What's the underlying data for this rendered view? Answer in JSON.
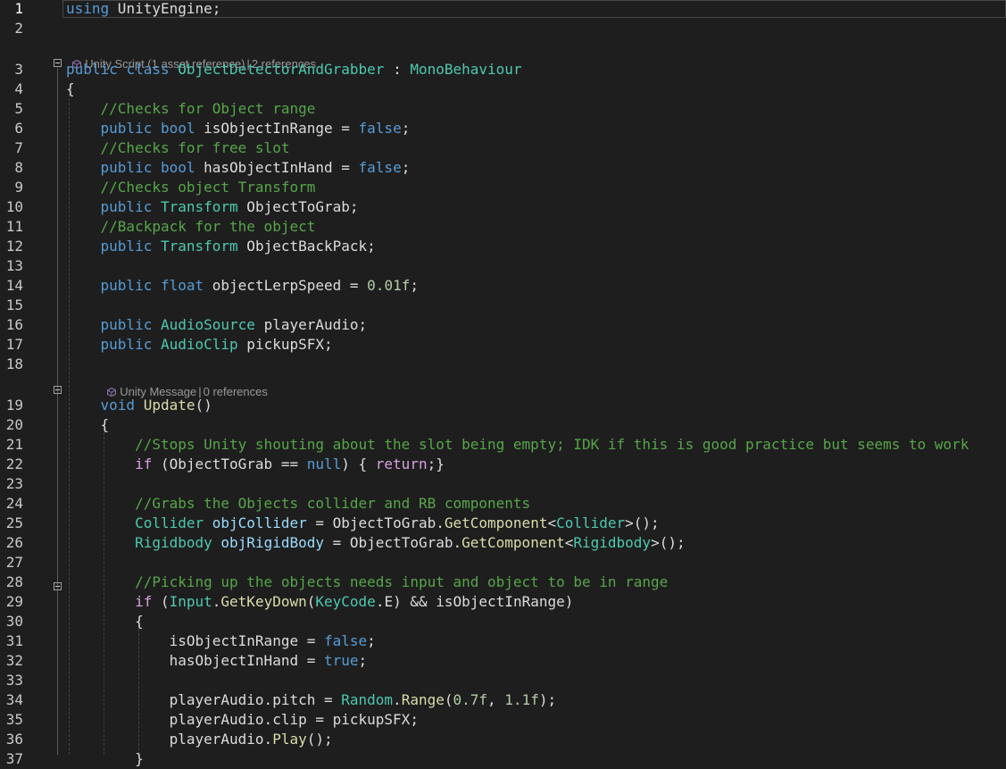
{
  "editor": {
    "line_numbers": [
      "1",
      "2",
      "3",
      "4",
      "5",
      "6",
      "7",
      "8",
      "9",
      "10",
      "11",
      "12",
      "13",
      "14",
      "15",
      "16",
      "17",
      "18",
      "19",
      "20",
      "21",
      "22",
      "23",
      "24",
      "25",
      "26",
      "27",
      "28",
      "29",
      "30",
      "31",
      "32",
      "33",
      "34",
      "35",
      "36",
      "37"
    ],
    "codelens": {
      "class_lens": {
        "kind": "Unity Script (1 asset reference)",
        "sep": "|",
        "refs": "2 references"
      },
      "method_lens": {
        "kind": "Unity Message",
        "sep": "|",
        "refs": "0 references"
      }
    },
    "lines": [
      [
        {
          "t": "using",
          "c": "kw"
        },
        {
          "t": " UnityEngine;",
          "c": "pl"
        }
      ],
      [],
      [
        {
          "t": "public",
          "c": "kw"
        },
        {
          "t": " ",
          "c": "pl"
        },
        {
          "t": "class",
          "c": "kw"
        },
        {
          "t": " ",
          "c": "pl"
        },
        {
          "t": "ObjectDetectorAndGrabber",
          "c": "cls"
        },
        {
          "t": " : ",
          "c": "pl"
        },
        {
          "t": "MonoBehaviour",
          "c": "cls"
        }
      ],
      [
        {
          "t": "{",
          "c": "pl"
        }
      ],
      [
        {
          "t": "    ",
          "c": "pl"
        },
        {
          "t": "//Checks for Object range",
          "c": "cm"
        }
      ],
      [
        {
          "t": "    ",
          "c": "pl"
        },
        {
          "t": "public",
          "c": "kw"
        },
        {
          "t": " ",
          "c": "pl"
        },
        {
          "t": "bool",
          "c": "kw"
        },
        {
          "t": " isObjectInRange = ",
          "c": "pl"
        },
        {
          "t": "false",
          "c": "kw"
        },
        {
          "t": ";",
          "c": "pl"
        }
      ],
      [
        {
          "t": "    ",
          "c": "pl"
        },
        {
          "t": "//Checks for free slot",
          "c": "cm"
        }
      ],
      [
        {
          "t": "    ",
          "c": "pl"
        },
        {
          "t": "public",
          "c": "kw"
        },
        {
          "t": " ",
          "c": "pl"
        },
        {
          "t": "bool",
          "c": "kw"
        },
        {
          "t": " hasObjectInHand = ",
          "c": "pl"
        },
        {
          "t": "false",
          "c": "kw"
        },
        {
          "t": ";",
          "c": "pl"
        }
      ],
      [
        {
          "t": "    ",
          "c": "pl"
        },
        {
          "t": "//Checks object Transform",
          "c": "cm"
        }
      ],
      [
        {
          "t": "    ",
          "c": "pl"
        },
        {
          "t": "public",
          "c": "kw"
        },
        {
          "t": " ",
          "c": "pl"
        },
        {
          "t": "Transform",
          "c": "cls"
        },
        {
          "t": " ObjectToGrab;",
          "c": "pl"
        }
      ],
      [
        {
          "t": "    ",
          "c": "pl"
        },
        {
          "t": "//Backpack for the object",
          "c": "cm"
        }
      ],
      [
        {
          "t": "    ",
          "c": "pl"
        },
        {
          "t": "public",
          "c": "kw"
        },
        {
          "t": " ",
          "c": "pl"
        },
        {
          "t": "Transform",
          "c": "cls"
        },
        {
          "t": " ObjectBackPack;",
          "c": "pl"
        }
      ],
      [],
      [
        {
          "t": "    ",
          "c": "pl"
        },
        {
          "t": "public",
          "c": "kw"
        },
        {
          "t": " ",
          "c": "pl"
        },
        {
          "t": "float",
          "c": "kw"
        },
        {
          "t": " objectLerpSpeed = ",
          "c": "pl"
        },
        {
          "t": "0.01f",
          "c": "num"
        },
        {
          "t": ";",
          "c": "pl"
        }
      ],
      [],
      [
        {
          "t": "    ",
          "c": "pl"
        },
        {
          "t": "public",
          "c": "kw"
        },
        {
          "t": " ",
          "c": "pl"
        },
        {
          "t": "AudioSource",
          "c": "cls"
        },
        {
          "t": " playerAudio;",
          "c": "pl"
        }
      ],
      [
        {
          "t": "    ",
          "c": "pl"
        },
        {
          "t": "public",
          "c": "kw"
        },
        {
          "t": " ",
          "c": "pl"
        },
        {
          "t": "AudioClip",
          "c": "cls"
        },
        {
          "t": " pickupSFX;",
          "c": "pl"
        }
      ],
      [],
      [
        {
          "t": "    ",
          "c": "pl"
        },
        {
          "t": "void",
          "c": "kw"
        },
        {
          "t": " ",
          "c": "pl"
        },
        {
          "t": "Update",
          "c": "mth"
        },
        {
          "t": "()",
          "c": "pl"
        }
      ],
      [
        {
          "t": "    {",
          "c": "pl"
        }
      ],
      [
        {
          "t": "        ",
          "c": "pl"
        },
        {
          "t": "//Stops Unity shouting about the slot being empty; IDK if this is good practice but seems to work",
          "c": "cm"
        }
      ],
      [
        {
          "t": "        ",
          "c": "pl"
        },
        {
          "t": "if",
          "c": "ctl"
        },
        {
          "t": " (ObjectToGrab == ",
          "c": "pl"
        },
        {
          "t": "null",
          "c": "kw"
        },
        {
          "t": ") { ",
          "c": "pl"
        },
        {
          "t": "return",
          "c": "ctl"
        },
        {
          "t": ";}",
          "c": "pl"
        }
      ],
      [],
      [
        {
          "t": "        ",
          "c": "pl"
        },
        {
          "t": "//Grabs the Objects collider and RB components",
          "c": "cm"
        }
      ],
      [
        {
          "t": "        ",
          "c": "pl"
        },
        {
          "t": "Collider",
          "c": "cls"
        },
        {
          "t": " ",
          "c": "pl"
        },
        {
          "t": "objCollider",
          "c": "var"
        },
        {
          "t": " = ObjectToGrab.",
          "c": "pl"
        },
        {
          "t": "GetComponent",
          "c": "mth"
        },
        {
          "t": "<",
          "c": "pl"
        },
        {
          "t": "Collider",
          "c": "cls"
        },
        {
          "t": ">();",
          "c": "pl"
        }
      ],
      [
        {
          "t": "        ",
          "c": "pl"
        },
        {
          "t": "Rigidbody",
          "c": "cls"
        },
        {
          "t": " ",
          "c": "pl"
        },
        {
          "t": "objRigidBody",
          "c": "var"
        },
        {
          "t": " = ObjectToGrab.",
          "c": "pl"
        },
        {
          "t": "GetComponent",
          "c": "mth"
        },
        {
          "t": "<",
          "c": "pl"
        },
        {
          "t": "Rigidbody",
          "c": "cls"
        },
        {
          "t": ">();",
          "c": "pl"
        }
      ],
      [],
      [
        {
          "t": "        ",
          "c": "pl"
        },
        {
          "t": "//Picking up the objects needs input and object to be in range",
          "c": "cm"
        }
      ],
      [
        {
          "t": "        ",
          "c": "pl"
        },
        {
          "t": "if",
          "c": "ctl"
        },
        {
          "t": " (",
          "c": "pl"
        },
        {
          "t": "Input",
          "c": "cls"
        },
        {
          "t": ".",
          "c": "pl"
        },
        {
          "t": "GetKeyDown",
          "c": "mth"
        },
        {
          "t": "(",
          "c": "pl"
        },
        {
          "t": "KeyCode",
          "c": "cls"
        },
        {
          "t": ".E) && isObjectInRange)",
          "c": "pl"
        }
      ],
      [
        {
          "t": "        {",
          "c": "pl"
        }
      ],
      [
        {
          "t": "            isObjectInRange = ",
          "c": "pl"
        },
        {
          "t": "false",
          "c": "kw"
        },
        {
          "t": ";",
          "c": "pl"
        }
      ],
      [
        {
          "t": "            hasObjectInHand = ",
          "c": "pl"
        },
        {
          "t": "true",
          "c": "kw"
        },
        {
          "t": ";",
          "c": "pl"
        }
      ],
      [],
      [
        {
          "t": "            playerAudio.pitch = ",
          "c": "pl"
        },
        {
          "t": "Random",
          "c": "cls"
        },
        {
          "t": ".",
          "c": "pl"
        },
        {
          "t": "Range",
          "c": "mth"
        },
        {
          "t": "(",
          "c": "pl"
        },
        {
          "t": "0.7f",
          "c": "num"
        },
        {
          "t": ", ",
          "c": "pl"
        },
        {
          "t": "1.1f",
          "c": "num"
        },
        {
          "t": ");",
          "c": "pl"
        }
      ],
      [
        {
          "t": "            playerAudio.clip = pickupSFX;",
          "c": "pl"
        }
      ],
      [
        {
          "t": "            playerAudio.",
          "c": "pl"
        },
        {
          "t": "Play",
          "c": "mth"
        },
        {
          "t": "();",
          "c": "pl"
        }
      ],
      [
        {
          "t": "        }",
          "c": "pl"
        }
      ]
    ]
  }
}
